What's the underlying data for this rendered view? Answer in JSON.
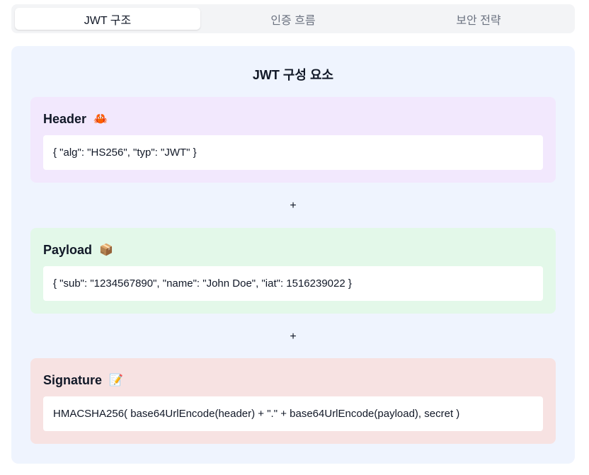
{
  "tabs": [
    {
      "label": "JWT 구조",
      "active": true
    },
    {
      "label": "인증 흐름",
      "active": false
    },
    {
      "label": "보안 전략",
      "active": false
    }
  ],
  "panel": {
    "title": "JWT 구성 요소",
    "parts": [
      {
        "name": "Header",
        "icon": "🦀",
        "icon_name": "crab-icon",
        "code": "{ \"alg\": \"HS256\", \"typ\": \"JWT\" }",
        "bg": "#f2e8fd"
      },
      {
        "name": "Payload",
        "icon": "📦",
        "icon_name": "package-icon",
        "code": "{ \"sub\": \"1234567890\", \"name\": \"John Doe\", \"iat\": 1516239022 }",
        "bg": "#e3f8e9"
      },
      {
        "name": "Signature",
        "icon": "📝",
        "icon_name": "memo-icon",
        "code": "HMACSHA256( base64UrlEncode(header) + \".\" + base64UrlEncode(payload), secret )",
        "bg": "#f7e2e2"
      }
    ],
    "separator": "+"
  },
  "colors": {
    "panel_bg": "#eff4fe",
    "tabbar_bg": "#f3f4f6",
    "header_bg": "#f2e8fd",
    "payload_bg": "#e3f8e9",
    "signature_bg": "#f7e2e2"
  }
}
